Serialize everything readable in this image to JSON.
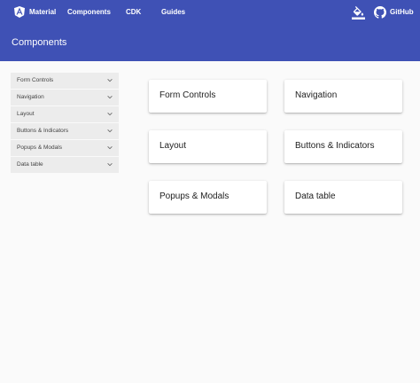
{
  "topbar": {
    "brand": "Material",
    "nav_components": "Components",
    "nav_cdk": "CDK",
    "nav_guides": "Guides",
    "github": "GitHub",
    "icons": {
      "logo": "angular-logo-icon",
      "theme": "theme-picker-icon",
      "github": "github-icon"
    }
  },
  "header": {
    "title": "Components"
  },
  "sidenav": {
    "items": [
      {
        "label": "Form Controls"
      },
      {
        "label": "Navigation"
      },
      {
        "label": "Layout"
      },
      {
        "label": "Buttons & Indicators"
      },
      {
        "label": "Popups & Modals"
      },
      {
        "label": "Data table"
      }
    ]
  },
  "cards": [
    {
      "label": "Form Controls"
    },
    {
      "label": "Navigation"
    },
    {
      "label": "Layout"
    },
    {
      "label": "Buttons & Indicators"
    },
    {
      "label": "Popups & Modals"
    },
    {
      "label": "Data table"
    }
  ],
  "colors": {
    "primary": "#3f51b5",
    "background": "#fafafa",
    "sidenav_item": "#ececec",
    "card": "#ffffff"
  }
}
